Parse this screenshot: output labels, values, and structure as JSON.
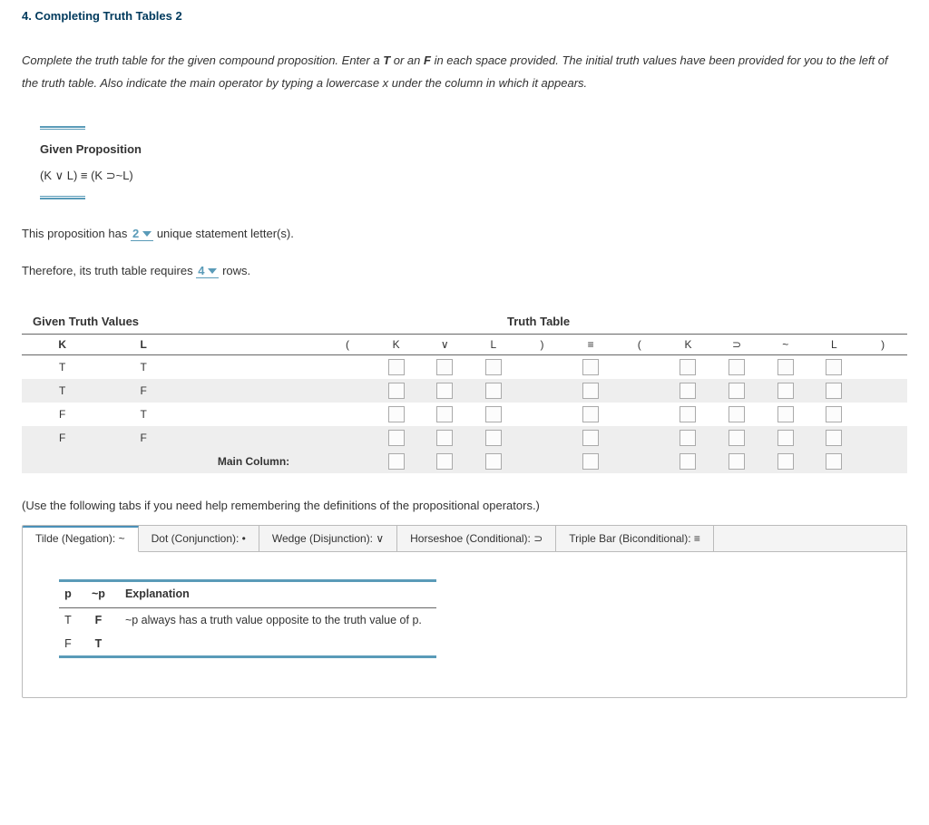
{
  "title": "4. Completing Truth Tables 2",
  "instructions_pre": "Complete the truth table for the given compound proposition. Enter a ",
  "instructions_T": "T",
  "instructions_mid1": " or an ",
  "instructions_F": "F",
  "instructions_post": " in each space provided. The initial truth values have been provided for you to the left of the truth table. Also indicate the main operator by typing a lowercase x under the column in which it appears.",
  "given_prop_label": "Given Proposition",
  "given_prop_formula": "(K ∨ L) ≡ (K ⊃~L)",
  "stmt1_pre": "This proposition has ",
  "stmt1_val": "2",
  "stmt1_post": " unique statement letter(s).",
  "stmt2_pre": "Therefore, its truth table requires ",
  "stmt2_val": "4",
  "stmt2_post": " rows.",
  "section_given": "Given Truth Values",
  "section_tt": "Truth Table",
  "headers": {
    "K": "K",
    "L": "L",
    "lp1": "(",
    "k2": "K",
    "or": "∨",
    "l2": "L",
    "rp1": ")",
    "eq": "≡",
    "lp2": "(",
    "k3": "K",
    "hs": "⊃",
    "neg": "~",
    "l3": "L",
    "rp2": ")"
  },
  "rows": [
    {
      "K": "T",
      "L": "T"
    },
    {
      "K": "T",
      "L": "F"
    },
    {
      "K": "F",
      "L": "T"
    },
    {
      "K": "F",
      "L": "F"
    }
  ],
  "main_col_label": "Main Column:",
  "help_note": "(Use the following tabs if you need help remembering the definitions of the propositional operators.)",
  "tabs": [
    "Tilde (Negation): ~",
    "Dot (Conjunction): •",
    "Wedge (Disjunction): ∨",
    "Horseshoe (Conditional): ⊃",
    "Triple Bar (Biconditional): ≡"
  ],
  "mini": {
    "h_p": "p",
    "h_np": "~p",
    "h_exp": "Explanation",
    "r1_p": "T",
    "r1_np": "F",
    "r2_p": "F",
    "r2_np": "T",
    "exp": "~p always has a truth value opposite to the truth value of p."
  }
}
